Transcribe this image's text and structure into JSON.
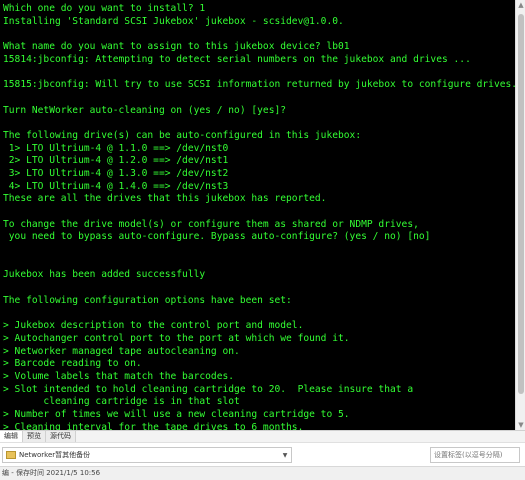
{
  "terminal": {
    "lines": [
      "Which one do you want to install? 1",
      "Installing 'Standard SCSI Jukebox' jukebox - scsidev@1.0.0.",
      "",
      "What name do you want to assign to this jukebox device? lb01",
      "15814:jbconfig: Attempting to detect serial numbers on the jukebox and drives ...",
      "",
      "15815:jbconfig: Will try to use SCSI information returned by jukebox to configure drives.",
      "",
      "Turn NetWorker auto-cleaning on (yes / no) [yes]?",
      "",
      "The following drive(s) can be auto-configured in this jukebox:",
      " 1> LTO Ultrium-4 @ 1.1.0 ==> /dev/nst0",
      " 2> LTO Ultrium-4 @ 1.2.0 ==> /dev/nst1",
      " 3> LTO Ultrium-4 @ 1.3.0 ==> /dev/nst2",
      " 4> LTO Ultrium-4 @ 1.4.0 ==> /dev/nst3",
      "These are all the drives that this jukebox has reported.",
      "",
      "To change the drive model(s) or configure them as shared or NDMP drives,",
      " you need to bypass auto-configure. Bypass auto-configure? (yes / no) [no]",
      "",
      "",
      "Jukebox has been added successfully",
      "",
      "The following configuration options have been set:",
      "",
      "> Jukebox description to the control port and model.",
      "> Autochanger control port to the port at which we found it.",
      "> Networker managed tape autocleaning on.",
      "> Barcode reading to on.",
      "> Volume labels that match the barcodes.",
      "> Slot intended to hold cleaning cartridge to 20.  Please insure that a",
      "       cleaning cartridge is in that slot",
      "> Number of times we will use a new cleaning cartridge to 5.",
      "> Cleaning interval for the tape drives to 6 months."
    ]
  },
  "tabs": [
    {
      "label": "编辑"
    },
    {
      "label": "预览"
    },
    {
      "label": "源代码"
    }
  ],
  "category": {
    "label": "Networker暂其他备份"
  },
  "tag_input": {
    "placeholder": "设置标签(以逗号分隔)"
  },
  "status": {
    "text": "编 - 保存时间 2021/1/5 10:56"
  },
  "colors": {
    "terminal_bg": "#000000",
    "terminal_fg": "#33ff33"
  }
}
